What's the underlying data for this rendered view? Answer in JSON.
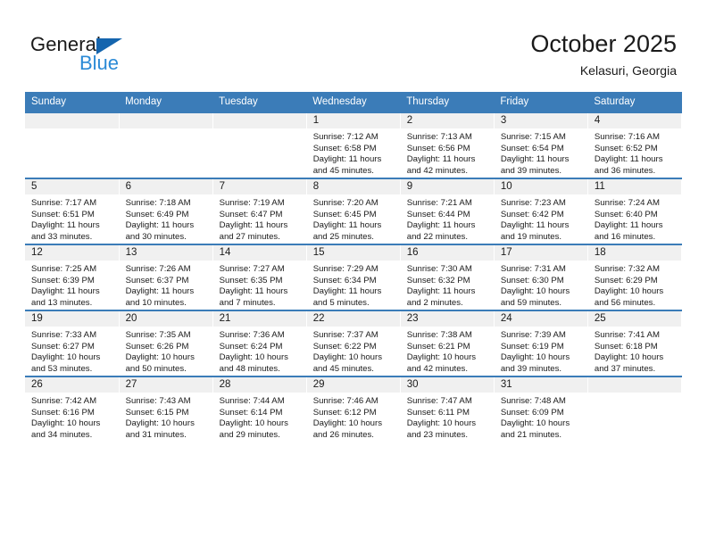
{
  "brand": {
    "name_top": "General",
    "name_bottom": "Blue",
    "accent_color": "#2b8ad6",
    "logo_triangle_color": "#1565AE"
  },
  "header": {
    "month_title": "October 2025",
    "location": "Kelasuri, Georgia"
  },
  "calendar": {
    "header_color": "#3B7CB8",
    "daynum_band_color": "#F0F0F0",
    "weekdays": [
      "Sunday",
      "Monday",
      "Tuesday",
      "Wednesday",
      "Thursday",
      "Friday",
      "Saturday"
    ],
    "weeks": [
      [
        {
          "day": "",
          "empty": true
        },
        {
          "day": "",
          "empty": true
        },
        {
          "day": "",
          "empty": true
        },
        {
          "day": "1",
          "sunrise": "Sunrise: 7:12 AM",
          "sunset": "Sunset: 6:58 PM",
          "daylight": "Daylight: 11 hours and 45 minutes."
        },
        {
          "day": "2",
          "sunrise": "Sunrise: 7:13 AM",
          "sunset": "Sunset: 6:56 PM",
          "daylight": "Daylight: 11 hours and 42 minutes."
        },
        {
          "day": "3",
          "sunrise": "Sunrise: 7:15 AM",
          "sunset": "Sunset: 6:54 PM",
          "daylight": "Daylight: 11 hours and 39 minutes."
        },
        {
          "day": "4",
          "sunrise": "Sunrise: 7:16 AM",
          "sunset": "Sunset: 6:52 PM",
          "daylight": "Daylight: 11 hours and 36 minutes."
        }
      ],
      [
        {
          "day": "5",
          "sunrise": "Sunrise: 7:17 AM",
          "sunset": "Sunset: 6:51 PM",
          "daylight": "Daylight: 11 hours and 33 minutes."
        },
        {
          "day": "6",
          "sunrise": "Sunrise: 7:18 AM",
          "sunset": "Sunset: 6:49 PM",
          "daylight": "Daylight: 11 hours and 30 minutes."
        },
        {
          "day": "7",
          "sunrise": "Sunrise: 7:19 AM",
          "sunset": "Sunset: 6:47 PM",
          "daylight": "Daylight: 11 hours and 27 minutes."
        },
        {
          "day": "8",
          "sunrise": "Sunrise: 7:20 AM",
          "sunset": "Sunset: 6:45 PM",
          "daylight": "Daylight: 11 hours and 25 minutes."
        },
        {
          "day": "9",
          "sunrise": "Sunrise: 7:21 AM",
          "sunset": "Sunset: 6:44 PM",
          "daylight": "Daylight: 11 hours and 22 minutes."
        },
        {
          "day": "10",
          "sunrise": "Sunrise: 7:23 AM",
          "sunset": "Sunset: 6:42 PM",
          "daylight": "Daylight: 11 hours and 19 minutes."
        },
        {
          "day": "11",
          "sunrise": "Sunrise: 7:24 AM",
          "sunset": "Sunset: 6:40 PM",
          "daylight": "Daylight: 11 hours and 16 minutes."
        }
      ],
      [
        {
          "day": "12",
          "sunrise": "Sunrise: 7:25 AM",
          "sunset": "Sunset: 6:39 PM",
          "daylight": "Daylight: 11 hours and 13 minutes."
        },
        {
          "day": "13",
          "sunrise": "Sunrise: 7:26 AM",
          "sunset": "Sunset: 6:37 PM",
          "daylight": "Daylight: 11 hours and 10 minutes."
        },
        {
          "day": "14",
          "sunrise": "Sunrise: 7:27 AM",
          "sunset": "Sunset: 6:35 PM",
          "daylight": "Daylight: 11 hours and 7 minutes."
        },
        {
          "day": "15",
          "sunrise": "Sunrise: 7:29 AM",
          "sunset": "Sunset: 6:34 PM",
          "daylight": "Daylight: 11 hours and 5 minutes."
        },
        {
          "day": "16",
          "sunrise": "Sunrise: 7:30 AM",
          "sunset": "Sunset: 6:32 PM",
          "daylight": "Daylight: 11 hours and 2 minutes."
        },
        {
          "day": "17",
          "sunrise": "Sunrise: 7:31 AM",
          "sunset": "Sunset: 6:30 PM",
          "daylight": "Daylight: 10 hours and 59 minutes."
        },
        {
          "day": "18",
          "sunrise": "Sunrise: 7:32 AM",
          "sunset": "Sunset: 6:29 PM",
          "daylight": "Daylight: 10 hours and 56 minutes."
        }
      ],
      [
        {
          "day": "19",
          "sunrise": "Sunrise: 7:33 AM",
          "sunset": "Sunset: 6:27 PM",
          "daylight": "Daylight: 10 hours and 53 minutes."
        },
        {
          "day": "20",
          "sunrise": "Sunrise: 7:35 AM",
          "sunset": "Sunset: 6:26 PM",
          "daylight": "Daylight: 10 hours and 50 minutes."
        },
        {
          "day": "21",
          "sunrise": "Sunrise: 7:36 AM",
          "sunset": "Sunset: 6:24 PM",
          "daylight": "Daylight: 10 hours and 48 minutes."
        },
        {
          "day": "22",
          "sunrise": "Sunrise: 7:37 AM",
          "sunset": "Sunset: 6:22 PM",
          "daylight": "Daylight: 10 hours and 45 minutes."
        },
        {
          "day": "23",
          "sunrise": "Sunrise: 7:38 AM",
          "sunset": "Sunset: 6:21 PM",
          "daylight": "Daylight: 10 hours and 42 minutes."
        },
        {
          "day": "24",
          "sunrise": "Sunrise: 7:39 AM",
          "sunset": "Sunset: 6:19 PM",
          "daylight": "Daylight: 10 hours and 39 minutes."
        },
        {
          "day": "25",
          "sunrise": "Sunrise: 7:41 AM",
          "sunset": "Sunset: 6:18 PM",
          "daylight": "Daylight: 10 hours and 37 minutes."
        }
      ],
      [
        {
          "day": "26",
          "sunrise": "Sunrise: 7:42 AM",
          "sunset": "Sunset: 6:16 PM",
          "daylight": "Daylight: 10 hours and 34 minutes."
        },
        {
          "day": "27",
          "sunrise": "Sunrise: 7:43 AM",
          "sunset": "Sunset: 6:15 PM",
          "daylight": "Daylight: 10 hours and 31 minutes."
        },
        {
          "day": "28",
          "sunrise": "Sunrise: 7:44 AM",
          "sunset": "Sunset: 6:14 PM",
          "daylight": "Daylight: 10 hours and 29 minutes."
        },
        {
          "day": "29",
          "sunrise": "Sunrise: 7:46 AM",
          "sunset": "Sunset: 6:12 PM",
          "daylight": "Daylight: 10 hours and 26 minutes."
        },
        {
          "day": "30",
          "sunrise": "Sunrise: 7:47 AM",
          "sunset": "Sunset: 6:11 PM",
          "daylight": "Daylight: 10 hours and 23 minutes."
        },
        {
          "day": "31",
          "sunrise": "Sunrise: 7:48 AM",
          "sunset": "Sunset: 6:09 PM",
          "daylight": "Daylight: 10 hours and 21 minutes."
        },
        {
          "day": "",
          "empty": true
        }
      ]
    ]
  }
}
